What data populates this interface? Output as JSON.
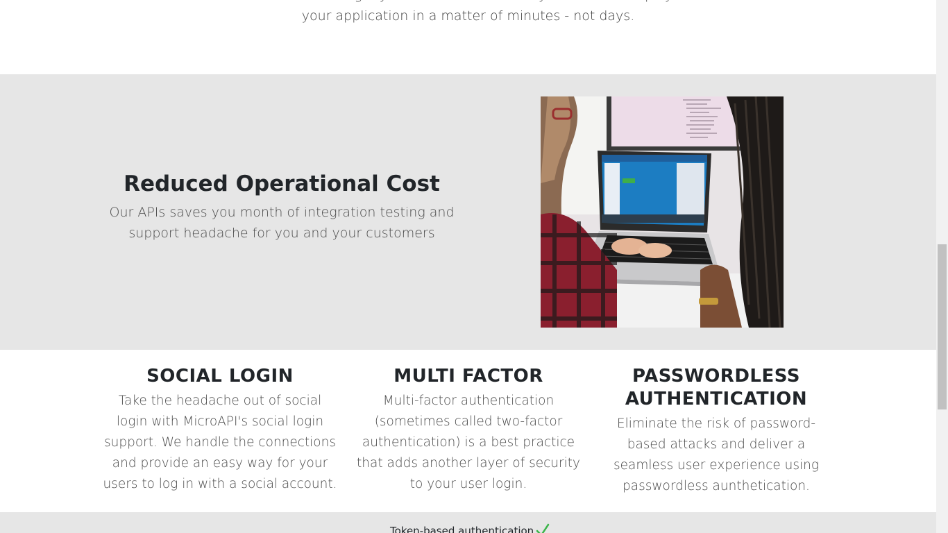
{
  "intro": {
    "text": "maintenance that come from building it yourself. Our API allows your team to deploy user aunthetication to your application in a matter of minutes - not days."
  },
  "feature": {
    "title": "Reduced Operational Cost",
    "text": "Our APIs saves you month of integration testing and support headache for you and your customers",
    "image_alt": "person-typing-on-laptop-photo"
  },
  "cards": [
    {
      "title": "SOCIAL LOGIN",
      "text": "Take the headache out of social login with MicroAPI's social login support. We handle the connections and provide an easy way for your users to log in with a social account."
    },
    {
      "title": "MULTI FACTOR",
      "text": "Multi-factor authentication (sometimes called two-factor authentication) is a best practice that adds another layer of security to your user login."
    },
    {
      "title": "PASSWORDLESS AUTHENTICATION",
      "text": "Eliminate the risk of password-based attacks and deliver a seamless user experience using passwordless aunthetication."
    }
  ],
  "strip": {
    "text": "Token-based authentication",
    "icon": "check-icon",
    "icon_color": "#3cb54a"
  },
  "colors": {
    "section_gray": "#e6e6e6",
    "heading": "#212529",
    "body_text": "#4a4a4a"
  }
}
